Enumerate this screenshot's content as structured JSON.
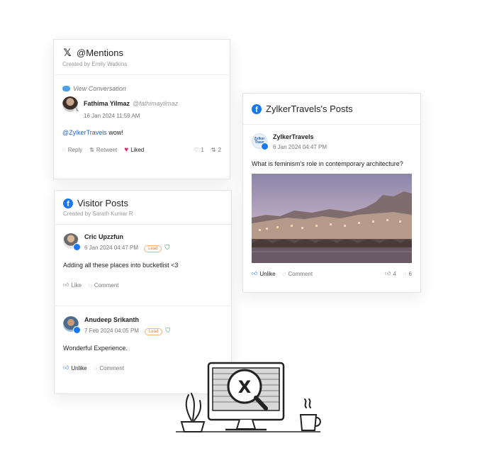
{
  "mentions_card": {
    "title": "@Mentions",
    "created_by": "Created by Emily Watkins",
    "view_conversation": "View Conversation",
    "post": {
      "author": "Fathima Yilmaz",
      "handle": "@fathimayilmaz",
      "time": "16 Jan 2024 11:59 AM",
      "mention": "@ZylkerTravels",
      "text": " wow!",
      "reply_label": "Reply",
      "retweet_label": "Retweet",
      "liked_label": "Liked",
      "likes": "1",
      "retweets": "2"
    }
  },
  "visitor_card": {
    "title": "Visitor Posts",
    "created_by": "Created by Sarath Kumar R",
    "posts": [
      {
        "author": "Cric Upzzfun",
        "time": "6 Jan 2024 04:47 PM",
        "badge": "Lead",
        "text": "Adding all these places into bucketlist <3",
        "like_label": "Like",
        "comment_label": "Comment"
      },
      {
        "author": "Anudeep Srikanth",
        "time": "7 Feb 2024 04:05 PM",
        "badge": "Lead",
        "text": "Wonderful Experience.",
        "like_label": "Unlike",
        "comment_label": "Comment"
      }
    ]
  },
  "zylker_card": {
    "title": "ZylkerTravels's Posts",
    "post": {
      "author": "ZylkerTravels",
      "avatar_text": "Zylker Trave",
      "time": "6 Jan 2024 04:47 PM",
      "text": "What is feminism's role in contemporary architecture?",
      "like_label": "Unlike",
      "comment_label": "Comment",
      "likes": "4",
      "comments": "6"
    }
  },
  "colors": {
    "facebook": "#1877f2",
    "heart": "#e0245e",
    "lead": "#e07a35",
    "mention": "#1f66d1"
  },
  "icons": [
    "x-icon",
    "facebook-icon",
    "chat-icon",
    "reply-icon",
    "retweet-icon",
    "heart-icon",
    "thumb-icon",
    "comment-icon",
    "tag-icon",
    "search-magnifier-icon",
    "monitor-icon",
    "plant-icon",
    "coffee-cup-icon"
  ]
}
